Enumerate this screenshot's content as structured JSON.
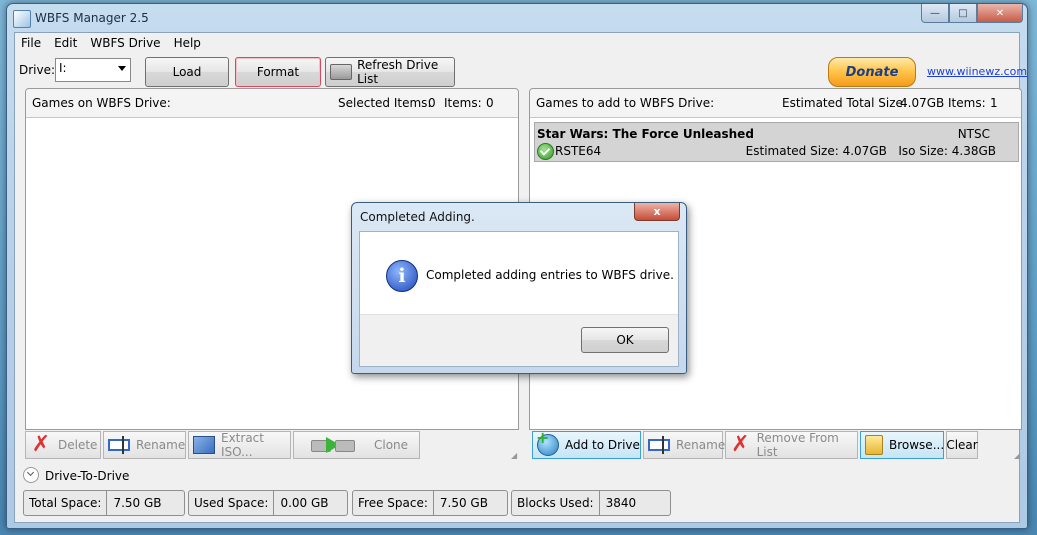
{
  "window": {
    "title": "WBFS Manager 2.5"
  },
  "menu": [
    "File",
    "Edit",
    "WBFS Drive",
    "Help"
  ],
  "drive": {
    "label": "Drive:",
    "value": "I:"
  },
  "buttons": {
    "load": "Load",
    "format": "Format",
    "refresh": "Refresh Drive List",
    "donate": "Donate"
  },
  "link": "www.wiinewz.com",
  "left_panel": {
    "title": "Games on WBFS Drive:",
    "selected_label": "Selected Items:",
    "selected_value": "0",
    "items_label": "Items:",
    "items_value": "0",
    "toolbar": {
      "delete": "Delete",
      "rename": "Rename",
      "extract": "Extract ISO...",
      "clone": "Clone"
    }
  },
  "right_panel": {
    "title": "Games to add to WBFS Drive:",
    "est_label": "Estimated Total Size:",
    "est_value": "4.07GB",
    "items_label": "Items:",
    "items_value": "1",
    "game": {
      "name": "Star Wars:  The Force Unleashed",
      "region": "NTSC",
      "id": "RSTE64",
      "est_size": "Estimated Size: 4.07GB",
      "iso_size": "Iso Size: 4.38GB"
    },
    "toolbar": {
      "add": "Add to Drive",
      "rename": "Rename",
      "remove": "Remove From List",
      "browse": "Browse...",
      "clear": "Clear"
    }
  },
  "drive_to_drive": "Drive-To-Drive",
  "status": {
    "total_label": "Total Space:",
    "total_value": "7.50 GB",
    "used_label": "Used Space:",
    "used_value": "0.00 GB",
    "free_label": "Free Space:",
    "free_value": "7.50 GB",
    "blocks_label": "Blocks Used:",
    "blocks_value": "3840"
  },
  "dialog": {
    "title": "Completed Adding.",
    "message": "Completed adding entries to WBFS drive.",
    "ok": "OK",
    "close": "x"
  },
  "icons": [
    "app-icon",
    "minimize-icon",
    "maximize-icon",
    "close-icon",
    "refresh-drive-icon",
    "check-icon",
    "delete-icon",
    "rename-icon",
    "extract-icon",
    "clone-icon",
    "add-icon",
    "remove-icon",
    "browse-icon",
    "expand-icon",
    "info-icon"
  ]
}
